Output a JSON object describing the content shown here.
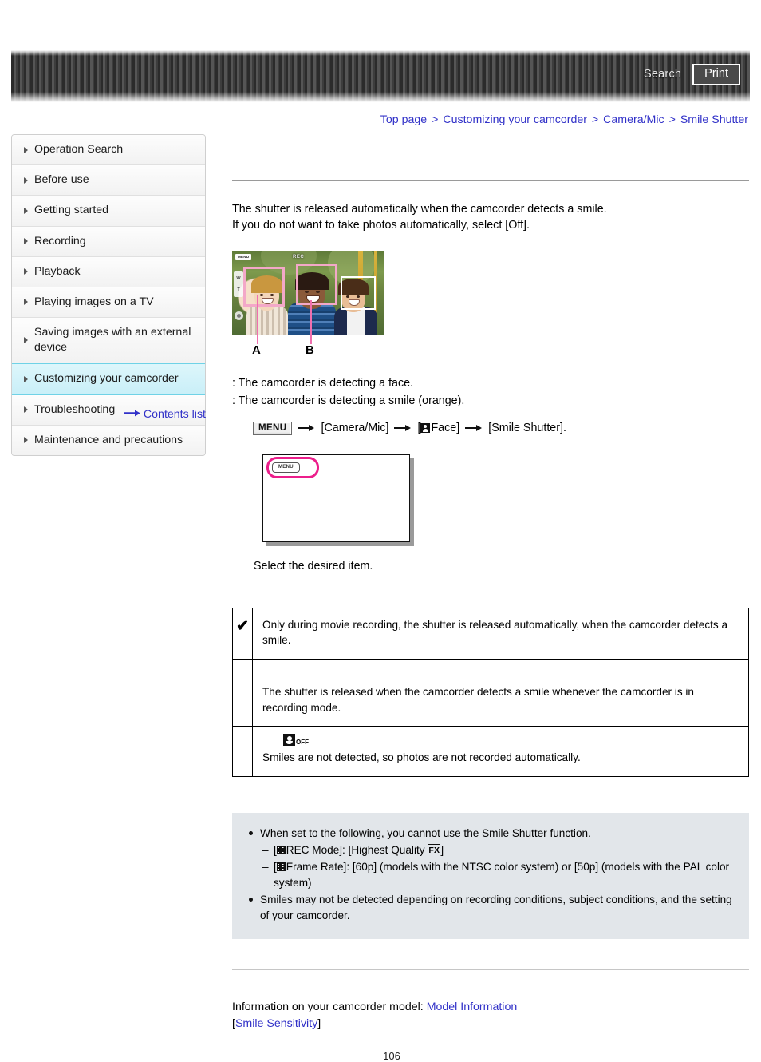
{
  "header": {
    "search_label": "Search",
    "print_label": "Print"
  },
  "breadcrumb": {
    "items": [
      "Top page",
      "Customizing your camcorder",
      "Camera/Mic",
      "Smile Shutter"
    ],
    "separator": ">"
  },
  "sidebar": {
    "items": [
      {
        "label": "Operation Search",
        "active": false
      },
      {
        "label": "Before use",
        "active": false
      },
      {
        "label": "Getting started",
        "active": false
      },
      {
        "label": "Recording",
        "active": false
      },
      {
        "label": "Playback",
        "active": false
      },
      {
        "label": "Playing images on a TV",
        "active": false
      },
      {
        "label": "Saving images with an external device",
        "active": false
      },
      {
        "label": "Customizing your camcorder",
        "active": true
      },
      {
        "label": "Troubleshooting",
        "active": false
      },
      {
        "label": "Maintenance and precautions",
        "active": false
      }
    ],
    "contents_link": "Contents list"
  },
  "main": {
    "intro_line1": "The shutter is released automatically when the camcorder detects a smile.",
    "intro_line2": "If you do not want to take photos automatically, select [Off].",
    "illustration": {
      "lcd_menu_label": "MENU",
      "lcd_rec_label": "REC",
      "lcd_zoom_w": "W",
      "lcd_zoom_t": "T",
      "label_a": "A",
      "label_b": "B"
    },
    "desc_a": ": The camcorder is detecting a face.",
    "desc_b": ": The camcorder is detecting a smile (orange).",
    "path": {
      "menu_chip": "MENU",
      "step1": "[Camera/Mic]",
      "step2_open": "[",
      "step2_label": "Face]",
      "step3": "[Smile Shutter]."
    },
    "screen_diagram": {
      "menu_button_label": "MENU"
    },
    "select_note": "Select the desired item.",
    "options": [
      {
        "mark": "✔",
        "icon": "",
        "text": "Only during movie recording, the shutter is released automatically, when the camcorder detects a smile."
      },
      {
        "mark": "",
        "icon": "",
        "text": "The shutter is released when the camcorder detects a smile whenever the camcorder is in recording mode."
      },
      {
        "mark": "",
        "icon": "smile-off-icon",
        "icon_suffix": "OFF",
        "text": "Smiles are not detected, so photos are not recorded automatically."
      }
    ],
    "notes": {
      "item1": "When set to the following, you cannot use the Smile Shutter function.",
      "sub1_pre": "[",
      "sub1_label": "REC Mode]: [Highest Quality",
      "sub1_fx": "FX",
      "sub1_post": "]",
      "sub2_pre": "[",
      "sub2_label": "Frame Rate]: [60p] (models with the NTSC color system) or [50p] (models with the PAL color system)",
      "item2": "Smiles may not be detected depending on recording conditions, subject conditions, and the setting of your camcorder."
    },
    "footer": {
      "model_prefix": "Information on your camcorder model:",
      "model_link": "Model Information",
      "sensitivity_open": "[",
      "sensitivity_link": "Smile Sensitivity",
      "sensitivity_close": "]",
      "page_number": "106"
    }
  },
  "colors": {
    "link": "#3131c8",
    "highlight": "#ec1e8b",
    "sidebar_active": "#c9eff8"
  }
}
